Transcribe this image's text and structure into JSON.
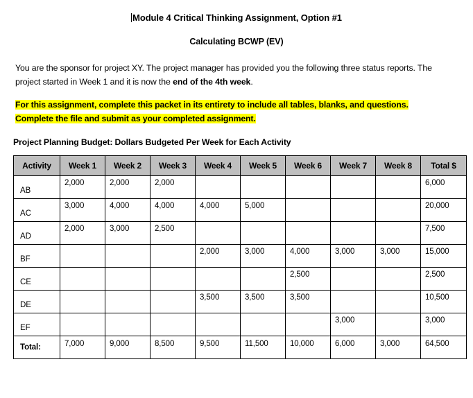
{
  "document": {
    "title": "Module 4 Critical Thinking Assignment, Option #1",
    "subtitle": "Calculating BCWP (EV)",
    "intro_part1": "You are the sponsor for project XY. The project manager has provided you the following three status reports. The project started in Week 1 and it is now the ",
    "intro_bold": "end of the 4th week",
    "intro_part2": ".",
    "highlight_line1": "For this assignment, complete this packet in its entirety to include all tables, blanks, and questions.",
    "highlight_line2": "Complete the file and submit as your completed assignment.",
    "highlight_color": "#FFFF00",
    "table_caption": "Project Planning Budget: Dollars Budgeted Per Week for Each Activity"
  },
  "table": {
    "header_background": "#BFBFBF",
    "border_color": "#000000",
    "columns": [
      "Activity",
      "Week 1",
      "Week 2",
      "Week 3",
      "Week 4",
      "Week 5",
      "Week 6",
      "Week 7",
      "Week 8",
      "Total $"
    ],
    "rows": [
      {
        "activity": "AB",
        "values": [
          "2,000",
          "2,000",
          "2,000",
          "",
          "",
          "",
          "",
          ""
        ],
        "total": "6,000"
      },
      {
        "activity": "AC",
        "values": [
          "3,000",
          "4,000",
          "4,000",
          "4,000",
          "5,000",
          "",
          "",
          ""
        ],
        "total": "20,000"
      },
      {
        "activity": "AD",
        "values": [
          "2,000",
          "3,000",
          "2,500",
          "",
          "",
          "",
          "",
          ""
        ],
        "total": "7,500"
      },
      {
        "activity": "BF",
        "values": [
          "",
          "",
          "",
          "2,000",
          "3,000",
          "4,000",
          "3,000",
          "3,000"
        ],
        "total": "15,000"
      },
      {
        "activity": "CE",
        "values": [
          "",
          "",
          "",
          "",
          "",
          "2,500",
          "",
          ""
        ],
        "total": "2,500"
      },
      {
        "activity": "DE",
        "values": [
          "",
          "",
          "",
          "3,500",
          "3,500",
          "3,500",
          "",
          ""
        ],
        "total": "10,500"
      },
      {
        "activity": "EF",
        "values": [
          "",
          "",
          "",
          "",
          "",
          "",
          "3,000",
          ""
        ],
        "total": "3,000"
      }
    ],
    "total_row": {
      "label": "Total:",
      "values": [
        "7,000",
        "9,000",
        "8,500",
        "9,500",
        "11,500",
        "10,000",
        "6,000",
        "3,000"
      ],
      "total": "64,500"
    }
  }
}
